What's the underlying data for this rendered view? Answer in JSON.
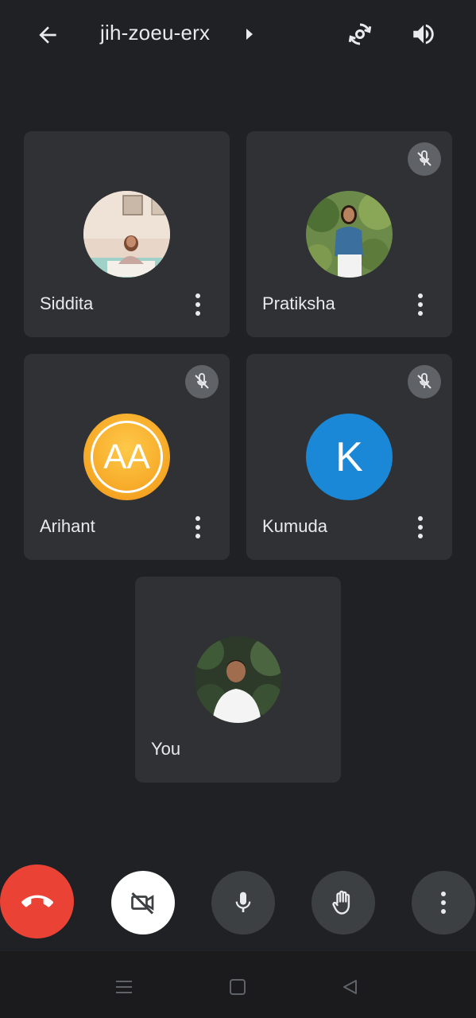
{
  "header": {
    "meeting_code": "jih-zoeu-erx"
  },
  "participants": [
    {
      "name": "Siddita",
      "muted": false,
      "avatar_type": "photo"
    },
    {
      "name": "Pratiksha",
      "muted": true,
      "avatar_type": "photo"
    },
    {
      "name": "Arihant",
      "muted": true,
      "avatar_type": "initials",
      "initials": "AA",
      "avatar_color": "#f5a623"
    },
    {
      "name": "Kumuda",
      "muted": true,
      "avatar_type": "letter",
      "initials": "K",
      "avatar_color": "#1a88d6"
    },
    {
      "name": "You",
      "muted": false,
      "avatar_type": "photo"
    }
  ],
  "controls": {
    "icons": [
      "end-call-icon",
      "camera-off-icon",
      "mic-icon",
      "raise-hand-icon",
      "more-options-icon"
    ],
    "end_call_color": "#ea4335"
  },
  "colors": {
    "background": "#202124",
    "tile": "#303134",
    "control_bg": "#3c4043"
  }
}
